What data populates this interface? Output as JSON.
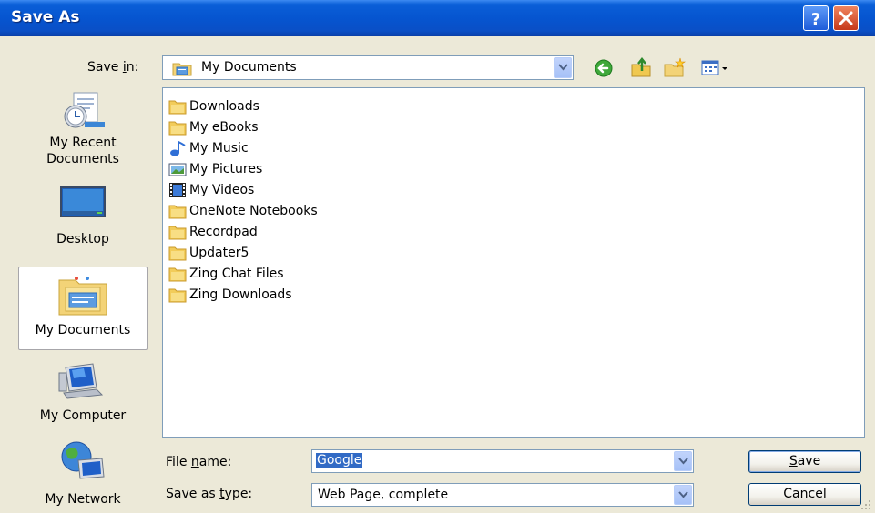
{
  "window": {
    "title": "Save As"
  },
  "toolbar": {
    "save_in_label_pre": "Save ",
    "save_in_label_ul": "i",
    "save_in_label_post": "n:",
    "save_in_value": "My Documents",
    "icons": [
      "back-arrow-icon",
      "up-folder-icon",
      "new-folder-icon",
      "view-menu-icon"
    ]
  },
  "places": [
    {
      "label_lines": [
        "My Recent",
        "Documents"
      ],
      "icon": "recent-documents-icon"
    },
    {
      "label_lines": [
        "Desktop"
      ],
      "icon": "desktop-icon"
    },
    {
      "label_lines": [
        "My Documents"
      ],
      "icon": "my-documents-icon",
      "selected": true
    },
    {
      "label_lines": [
        "My Computer"
      ],
      "icon": "my-computer-icon"
    },
    {
      "label_lines": [
        "My Network"
      ],
      "icon": "my-network-icon"
    }
  ],
  "files": [
    {
      "name": "Downloads",
      "icon": "folder-icon"
    },
    {
      "name": "My eBooks",
      "icon": "folder-icon"
    },
    {
      "name": "My Music",
      "icon": "music-note-icon"
    },
    {
      "name": "My Pictures",
      "icon": "pictures-icon"
    },
    {
      "name": "My Videos",
      "icon": "film-icon"
    },
    {
      "name": "OneNote Notebooks",
      "icon": "folder-icon"
    },
    {
      "name": "Recordpad",
      "icon": "folder-icon"
    },
    {
      "name": "Updater5",
      "icon": "folder-icon"
    },
    {
      "name": "Zing Chat Files",
      "icon": "folder-icon"
    },
    {
      "name": "Zing Downloads",
      "icon": "folder-icon"
    }
  ],
  "form": {
    "file_name_label_pre": "File ",
    "file_name_label_ul": "n",
    "file_name_label_post": "ame:",
    "file_name_value": "Google",
    "save_type_label_pre": "Save as ",
    "save_type_label_ul": "t",
    "save_type_label_post": "ype:",
    "save_type_value": "Web Page, complete"
  },
  "buttons": {
    "save_ul": "S",
    "save_rest": "ave",
    "cancel": "Cancel"
  }
}
